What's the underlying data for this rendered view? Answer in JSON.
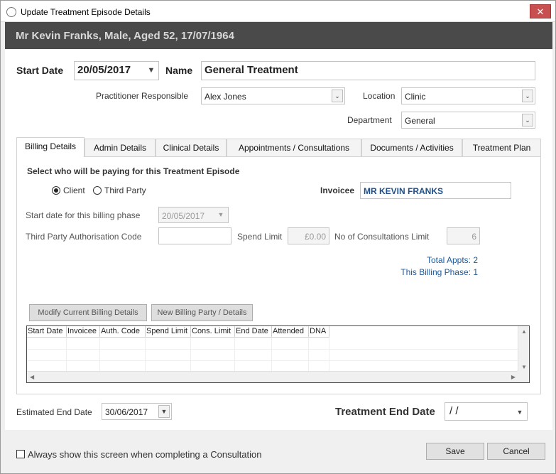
{
  "window": {
    "title": "Update Treatment Episode Details",
    "close_glyph": "✕"
  },
  "patient_header": "Mr Kevin Franks, Male, Aged 52, 17/07/1964",
  "episode": {
    "start_date_label": "Start Date",
    "start_date": "20/05/2017",
    "name_label": "Name",
    "name": "General Treatment",
    "practitioner_label": "Practitioner Responsible",
    "practitioner": "Alex Jones",
    "location_label": "Location",
    "location": "Clinic",
    "department_label": "Department",
    "department": "General"
  },
  "tabs": [
    {
      "label": "Billing Details"
    },
    {
      "label": "Admin Details"
    },
    {
      "label": "Clinical Details"
    },
    {
      "label": "Appointments / Consultations"
    },
    {
      "label": "Documents / Activities"
    },
    {
      "label": "Treatment Plan"
    }
  ],
  "billing": {
    "heading": "Select who will be paying for this Treatment Episode",
    "option_client": "Client",
    "option_third_party": "Third Party",
    "selected": "Client",
    "invoicee_label": "Invoicee",
    "invoicee": "MR KEVIN FRANKS",
    "phase_start_label": "Start date for this billing phase",
    "phase_start": "20/05/2017",
    "auth_code_label": "Third Party Authorisation Code",
    "auth_code": "",
    "spend_limit_label": "Spend Limit",
    "spend_limit": "£0.00",
    "consult_limit_label": "No of Consultations Limit",
    "consult_limit": "6",
    "total_appts": "Total Appts: 2",
    "this_phase": "This Billing Phase: 1",
    "modify_button": "Modify Current Billing Details",
    "new_party_button": "New Billing Party / Details",
    "grid_columns": [
      "Start Date",
      "Invoicee",
      "Auth. Code",
      "Spend Limit",
      "Cons. Limit",
      "End Date",
      "Attended",
      "DNA"
    ]
  },
  "end": {
    "estimated_label": "Estimated End Date",
    "estimated": "30/06/2017",
    "treatment_end_label": "Treatment End Date",
    "treatment_end": " /  /"
  },
  "footer": {
    "checkbox_label": "Always show this screen when completing a Consultation",
    "checkbox_checked": false,
    "save_label": "Save",
    "cancel_label": "Cancel"
  }
}
